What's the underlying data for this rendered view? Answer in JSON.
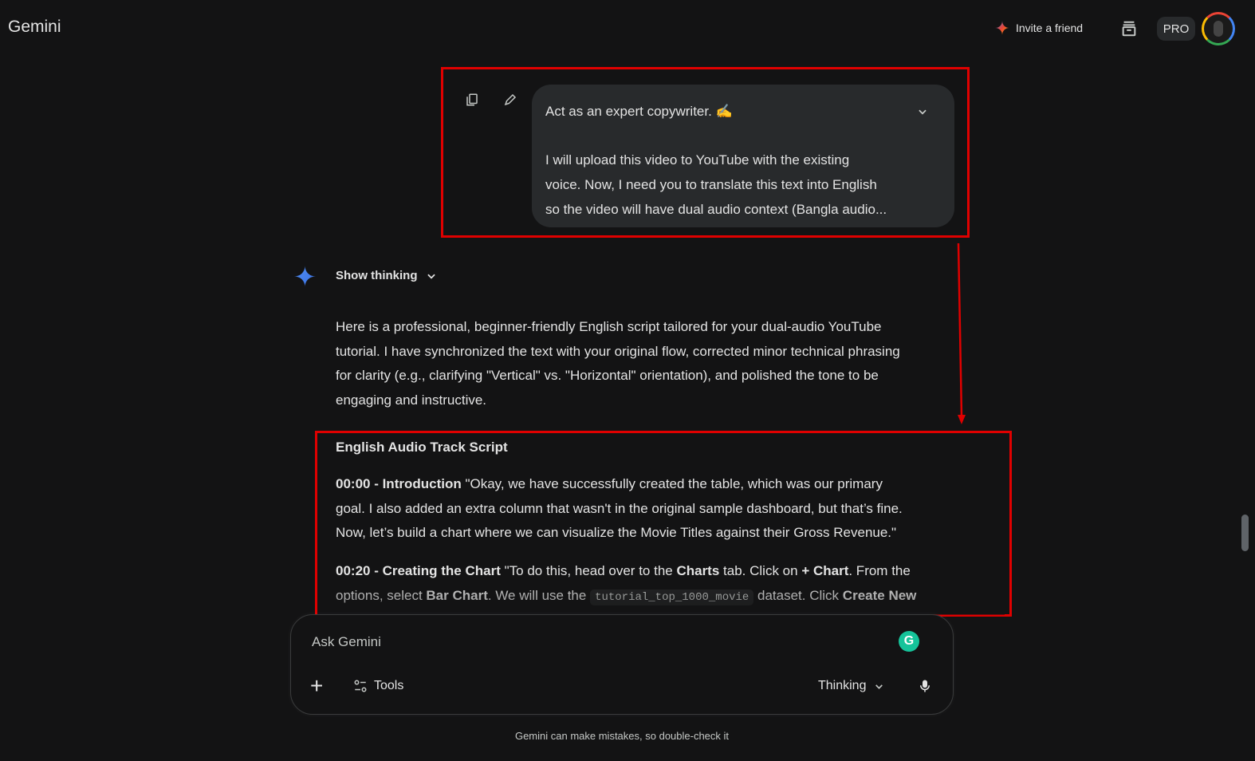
{
  "header": {
    "title": "Gemini",
    "invite_label": "Invite a friend",
    "pro_label": "PRO"
  },
  "user_prompt": {
    "lines": [
      "Act as an expert copywriter. ✍️",
      "",
      "I will upload this video to YouTube with the existing",
      "voice. Now, I need you to translate this text into English",
      "so the video will have dual audio context (Bangla audio..."
    ]
  },
  "response": {
    "show_thinking_label": "Show thinking",
    "intro_lines": [
      "Here is a professional, beginner-friendly English script tailored for your dual-audio YouTube",
      "tutorial. I have synchronized the text with your original flow, corrected minor technical phrasing",
      "for clarity (e.g., clarifying \"Vertical\" vs. \"Horizontal\" orientation), and polished the tone to be",
      "engaging and instructive."
    ],
    "script_title": "English Audio Track Script",
    "sections": [
      [
        [
          {
            "t": "00:00 - Introduction",
            "b": true
          },
          {
            "t": " \"Okay, we have successfully created the table, which was our primary"
          }
        ],
        [
          {
            "t": "goal. I also added an extra column that wasn't in the original sample dashboard, but that’s fine."
          }
        ],
        [
          {
            "t": "Now, let’s build a chart where we can visualize the Movie Titles against their Gross Revenue.\""
          }
        ]
      ],
      [
        [
          {
            "t": "00:20 - Creating the Chart",
            "b": true
          },
          {
            "t": " \"To do this, head over to the "
          },
          {
            "t": "Charts",
            "b": true
          },
          {
            "t": " tab. Click on "
          },
          {
            "t": "+ Chart",
            "b": true
          },
          {
            "t": ". From the"
          }
        ],
        [
          {
            "t": "options, select "
          },
          {
            "t": "Bar Chart",
            "b": true
          },
          {
            "t": ". We will use the "
          },
          {
            "t": "tutorial_top_1000_movie",
            "c": true
          },
          {
            "t": " dataset. Click "
          },
          {
            "t": "Create New",
            "b": true
          }
        ]
      ]
    ]
  },
  "composer": {
    "placeholder": "Ask Gemini",
    "tools_label": "Tools",
    "mode_label": "Thinking"
  },
  "footer": {
    "disclaimer": "Gemini can make mistakes, so double-check it"
  },
  "colors": {
    "annotation": "#e00000",
    "accent": "#4285f4"
  }
}
